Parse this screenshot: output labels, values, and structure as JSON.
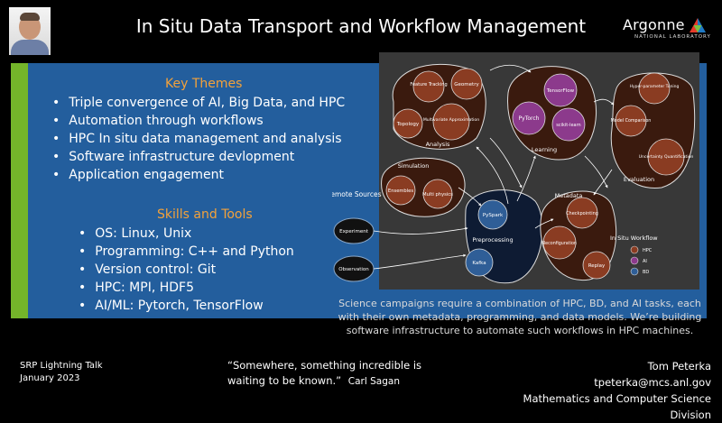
{
  "header": {
    "title": "In Situ Data Transport and Workflow Management",
    "logo_word": "Argonne",
    "logo_sub": "NATIONAL LABORATORY"
  },
  "themes": {
    "heading": "Key Themes",
    "items": [
      "Triple convergence of AI, Big Data, and HPC",
      "Automation through workflows",
      "HPC In situ data management and analysis",
      "Software infrastructure devlopment",
      "Application engagement"
    ]
  },
  "skills": {
    "heading": "Skills and Tools",
    "items": [
      "OS: Linux, Unix",
      "Programming: C++ and Python",
      "Version control: Git",
      "HPC: MPI, HDF5",
      "AI/ML: Pytorch, TensorFlow"
    ]
  },
  "diagram": {
    "remote_sources": "Remote Sources",
    "experiment": "Experiment",
    "observation": "Observation",
    "feature_tracking": "Feature Tracking",
    "geometry": "Geometry",
    "topology": "Topology",
    "multivariate": "Multivariate Approximation",
    "analysis": "Analysis",
    "tensorflow": "TensorFlow",
    "pytorch": "PyTorch",
    "scikit": "scikit-learn",
    "learning": "Learning",
    "hyperparam": "Hyper-parameter Tuning",
    "model_comparison": "Model Comparison",
    "uncertainty": "Uncertainty Quantification",
    "evaluation": "Evaluation",
    "simulation": "Simulation",
    "ensembles": "Ensembles",
    "multiphysics": "Multi physics",
    "pyspark": "PySpark",
    "preprocessing": "Preprocessing",
    "kafka": "Kafka",
    "metadata": "Metadata",
    "checkpointing": "Checkpointing",
    "reconfiguration": "Reconfiguration",
    "replay": "Replay",
    "legend_title": "In Situ Workflow",
    "legend_hpc": "HPC",
    "legend_ai": "AI",
    "legend_bd": "BD"
  },
  "colors": {
    "hpc": "#8a3c22",
    "ai": "#8c3a8c",
    "bd": "#2f5e97",
    "green_bar": "#74b52a",
    "panel": "#235e9d",
    "heading_orange": "#f3a23b"
  },
  "caption": "Science campaigns require a combination of HPC, BD, and AI tasks, each with their own metadata, programming, and data models.  We’re building software infrastructure to automate such workflows in HPC machines.",
  "footer": {
    "talk_line1": "SRP Lightning Talk",
    "talk_line2": "January 2023",
    "quote": "“Somewhere, something incredible is waiting to be known.”",
    "quote_author": "Carl Sagan",
    "name": "Tom Peterka",
    "email": "tpeterka@mcs.anl.gov",
    "division": "Mathematics and Computer Science Division"
  }
}
